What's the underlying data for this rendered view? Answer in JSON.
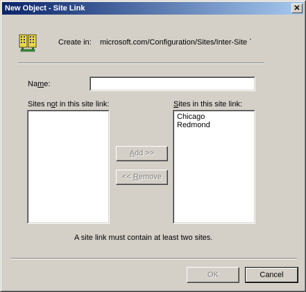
{
  "window": {
    "title": "New Object - Site Link",
    "close_glyph": "✕"
  },
  "header": {
    "icon": "site-link-buildings-icon",
    "create_in_label": "Create in:",
    "create_in_path": "microsoft.com/Configuration/Sites/Inter-Site `"
  },
  "form": {
    "name_label_pre": "Na",
    "name_label_accel": "m",
    "name_label_post": "e:",
    "name_value": "",
    "sites_not_label_pre": "Sites n",
    "sites_not_label_accel": "o",
    "sites_not_label_post": "t in this site link:",
    "sites_in_label_pre": "",
    "sites_in_label_accel": "S",
    "sites_in_label_post": "ites in this site link:",
    "sites_not_in": [],
    "sites_in": [
      "Chicago",
      "Redmond"
    ],
    "add_pre": "",
    "add_accel": "A",
    "add_post": "dd >>",
    "remove_pre": "<< ",
    "remove_accel": "R",
    "remove_post": "emove",
    "note": "A site link must contain at least two sites."
  },
  "footer": {
    "ok_label": "OK",
    "cancel_label": "Cancel"
  },
  "colors": {
    "face": "#d4d0c8",
    "title_start": "#0a246a",
    "title_end": "#a6caf0",
    "disabled_text": "#808080"
  }
}
